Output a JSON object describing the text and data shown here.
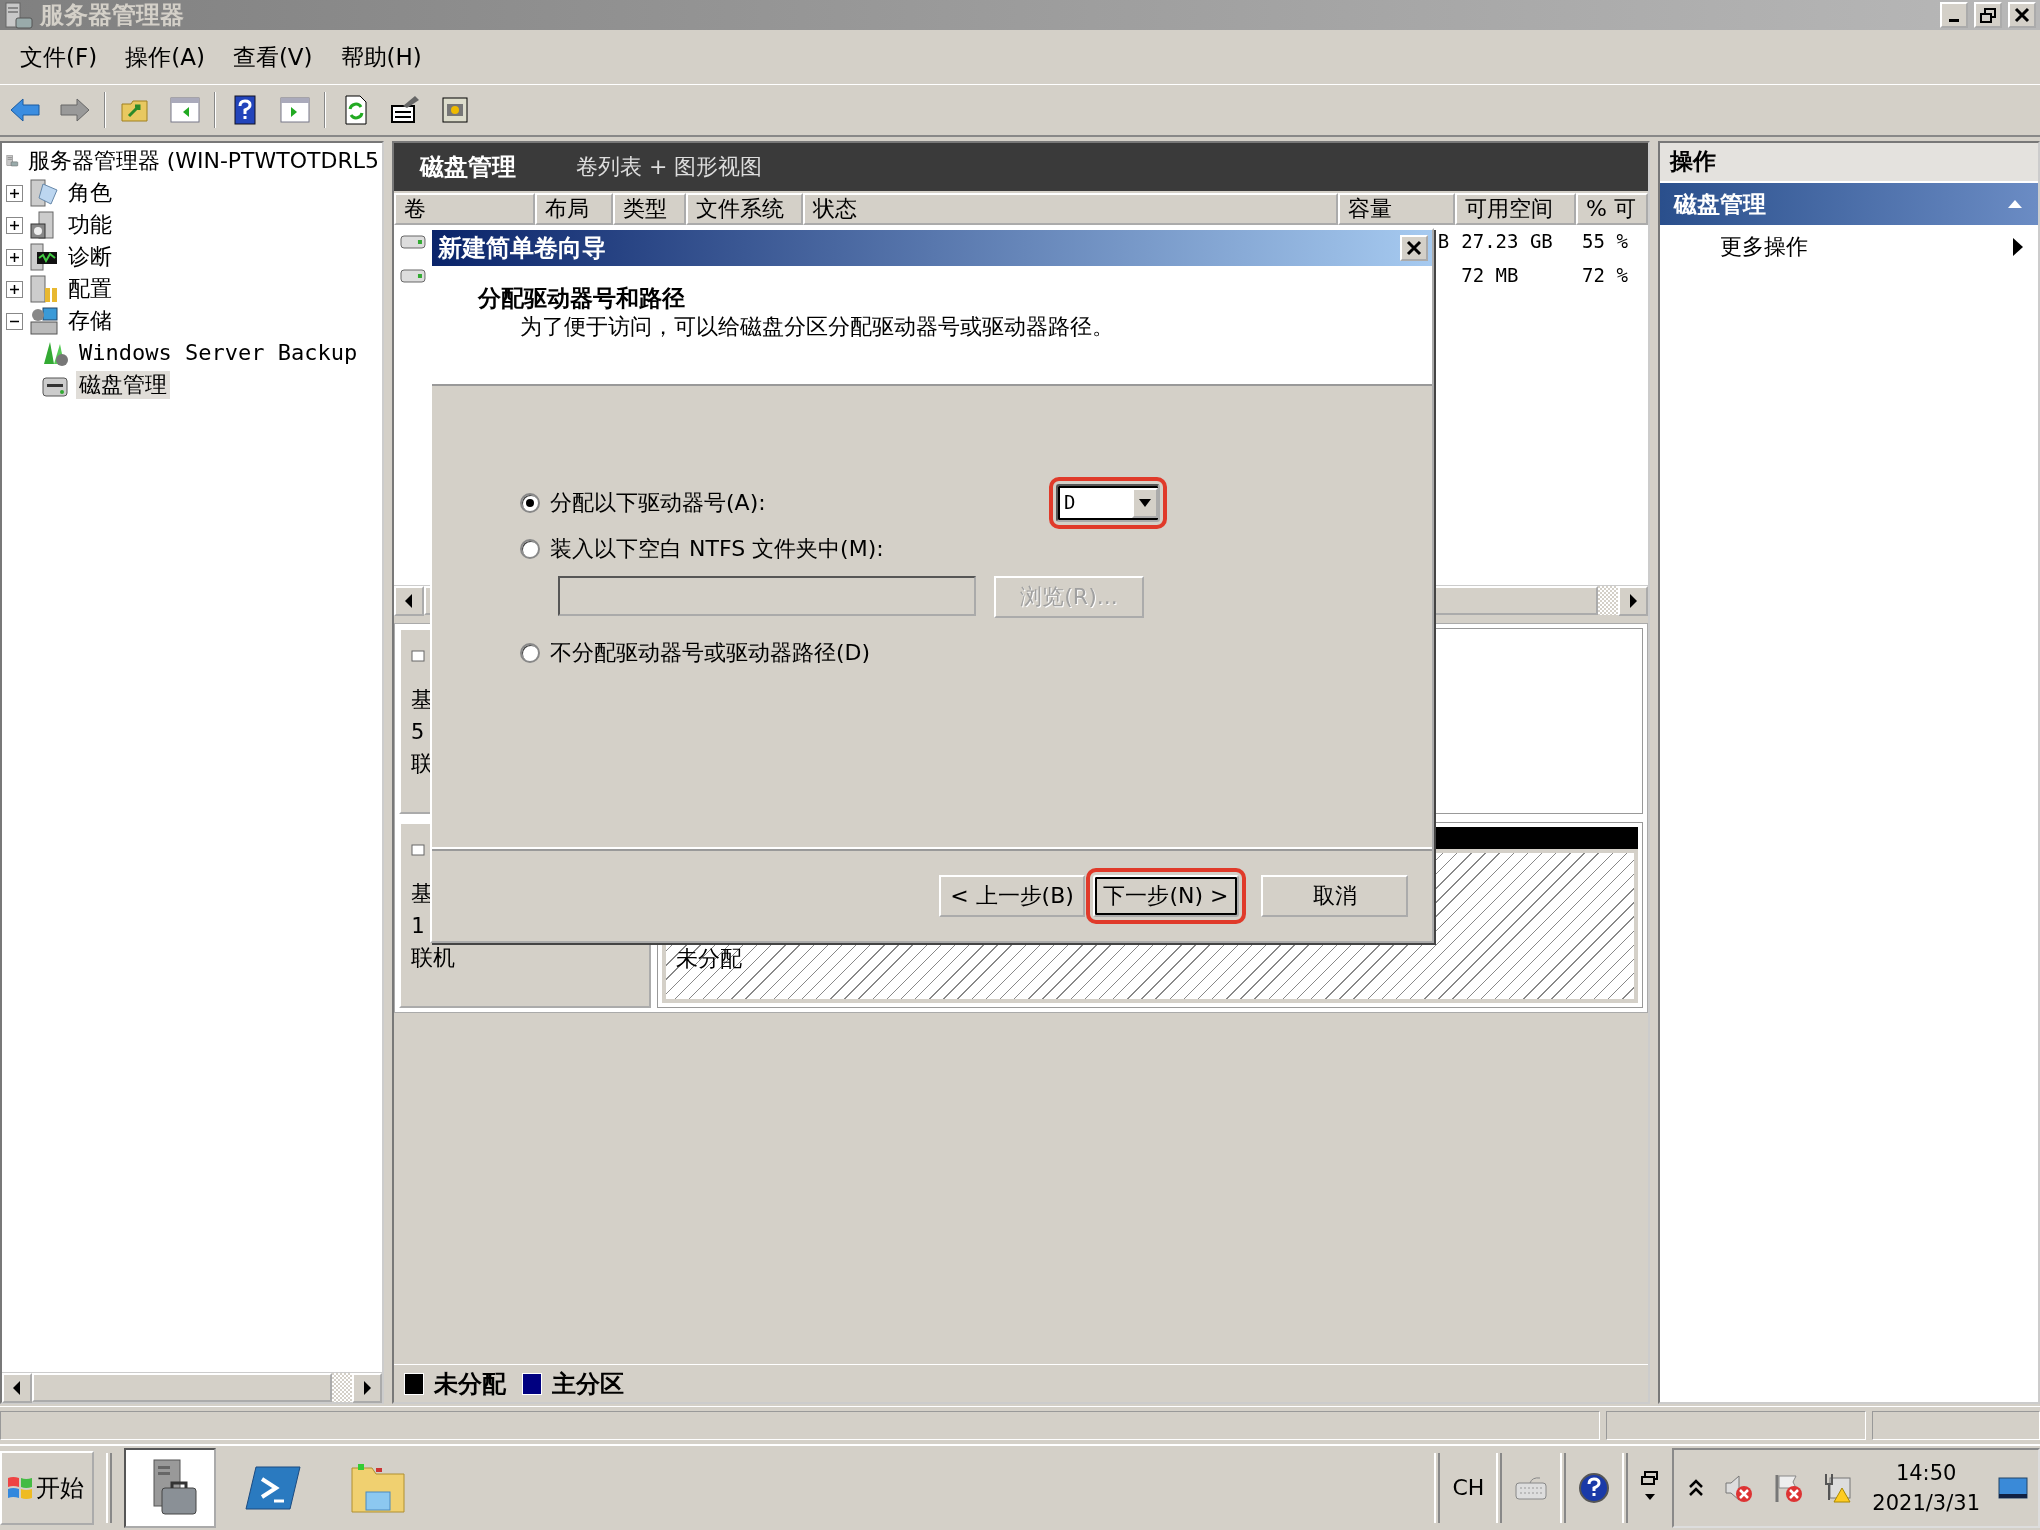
{
  "window": {
    "title": "服务器管理器"
  },
  "menu": [
    "文件(F)",
    "操作(A)",
    "查看(V)",
    "帮助(H)"
  ],
  "tree": {
    "label": "服务器管理器 (WIN-PTWTOTDRL5",
    "selected": false,
    "children": [
      {
        "label": "角色",
        "expanded": false,
        "selected": false
      },
      {
        "label": "功能",
        "expanded": false,
        "selected": false
      },
      {
        "label": "诊断",
        "expanded": false,
        "selected": false
      },
      {
        "label": "配置",
        "expanded": false,
        "selected": false
      },
      {
        "label": "存储",
        "expanded": true,
        "selected": false,
        "children": [
          {
            "label": "Windows Server Backup",
            "selected": false
          },
          {
            "label": "磁盘管理",
            "selected": true
          }
        ]
      }
    ]
  },
  "center": {
    "title": "磁盘管理",
    "subtitle": "卷列表 + 图形视图",
    "columns": [
      "卷",
      "布局",
      "类型",
      "文件系统",
      "状态",
      "容量",
      "可用空间",
      "% 可"
    ],
    "rows": [
      {
        "capacity": "B",
        "free": "27.23 GB",
        "percent": "55 %"
      },
      {
        "free": "72 MB",
        "percent": "72 %"
      }
    ],
    "disks": [
      {
        "lines": [
          "基",
          "5",
          "联"
        ]
      },
      {
        "lines": [
          "基",
          "1",
          "联机"
        ],
        "partition": "未分配"
      }
    ],
    "legend": [
      {
        "label": "未分配",
        "color": "#000000"
      },
      {
        "label": "主分区",
        "color": "#000080"
      }
    ]
  },
  "actions": {
    "title": "操作",
    "section": "磁盘管理",
    "items": [
      "更多操作"
    ]
  },
  "dialog": {
    "title": "新建简单卷向导",
    "heading": "分配驱动器号和路径",
    "description": "为了便于访问，可以给磁盘分区分配驱动器号或驱动器路径。",
    "options": [
      {
        "label": "分配以下驱动器号(A):",
        "selected": true
      },
      {
        "label": "装入以下空白 NTFS 文件夹中(M):",
        "selected": false
      },
      {
        "label": "不分配驱动器号或驱动器路径(D)",
        "selected": false
      }
    ],
    "drive_letter": {
      "value": "D",
      "highlighted": true
    },
    "path_field": {
      "disabled": true
    },
    "browse_button": {
      "label": "浏览(R)...",
      "disabled": true
    },
    "buttons": [
      {
        "label": "< 上一步(B)",
        "highlighted": false
      },
      {
        "label": "下一步(N) >",
        "highlighted": true
      },
      {
        "label": "取消",
        "highlighted": false
      }
    ]
  },
  "taskbar": {
    "start": "开始",
    "language": "CH",
    "time": "14:50",
    "date": "2021/3/31"
  }
}
